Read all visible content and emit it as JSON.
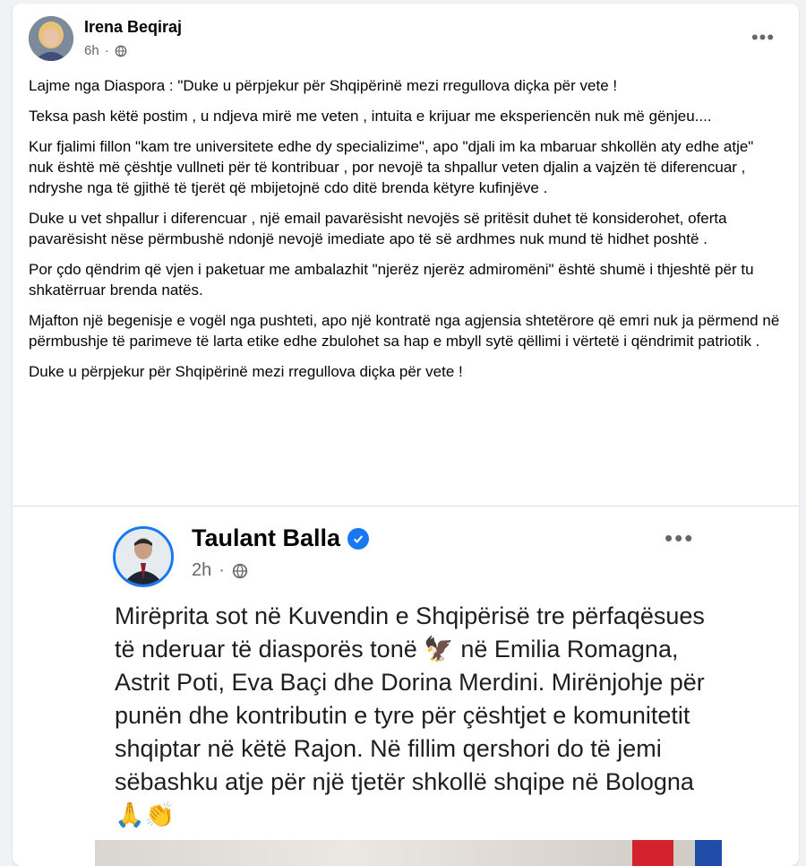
{
  "post": {
    "author": "Irena Beqiraj",
    "time": "6h",
    "privacy_icon": "globe-icon",
    "more_label": "•••",
    "paragraphs": [
      "Lajme nga Diaspora : \"Duke u përpjekur për Shqipërinë mezi rregullova diçka për vete !",
      "Teksa pash këtë postim , u ndjeva mirë me veten , intuita e krijuar me eksperiencën nuk më gënjeu....",
      "Kur fjalimi fillon \"kam tre universitete edhe dy specializime\", apo \"djali im ka mbaruar shkollën aty edhe atje\" nuk është më çështje vullneti për të kontribuar , por nevojë ta shpallur veten djalin a vajzën të diferencuar , ndryshe nga të gjithë të tjerët që mbijetojnë cdo ditë brenda këtyre kufinjëve .",
      "Duke u vet shpallur i diferencuar , një email pavarësisht nevojës së pritësit duhet të konsiderohet, oferta pavarësisht nëse përmbushë ndonjë nevojë imediate apo të së ardhmes nuk mund të hidhet poshtë .",
      "Por çdo qëndrim që vjen i paketuar me ambalazhit \"njerëz njerëz admiromëni\" është shumë i thjeshtë për tu shkatërruar brenda natës.",
      "Mjafton një begenisje e vogël nga pushteti, apo një kontratë nga agjensia shtetërore që emri nuk ja përmend në përmbushje të parimeve të larta etike edhe zbulohet sa hap e mbyll sytë qëllimi i vërtetë i qëndrimit patriotik .",
      "Duke u përpjekur për Shqipërinë mezi rregullova diçka për vete !"
    ]
  },
  "shared": {
    "author": "Taulant Balla",
    "verified_icon": "verified-badge-icon",
    "time": "2h",
    "more_label": "•••",
    "text": "Mirëprita sot në Kuvendin e Shqipërisë tre përfaqësues të nderuar të diasporës tonë 🦅 në Emilia Romagna, Astrit Poti, Eva Baçi dhe Dorina Merdini. Mirënjohje për punën dhe kontributin e tyre për çështjet e komunitetit shqiptar në këtë Rajon. Në fillim qershori do të jemi sëbashku atje për një tjetër shkollë shqipe në Bologna🙏👏"
  },
  "colors": {
    "accent": "#1877f2",
    "secondary_text": "#65676b"
  }
}
